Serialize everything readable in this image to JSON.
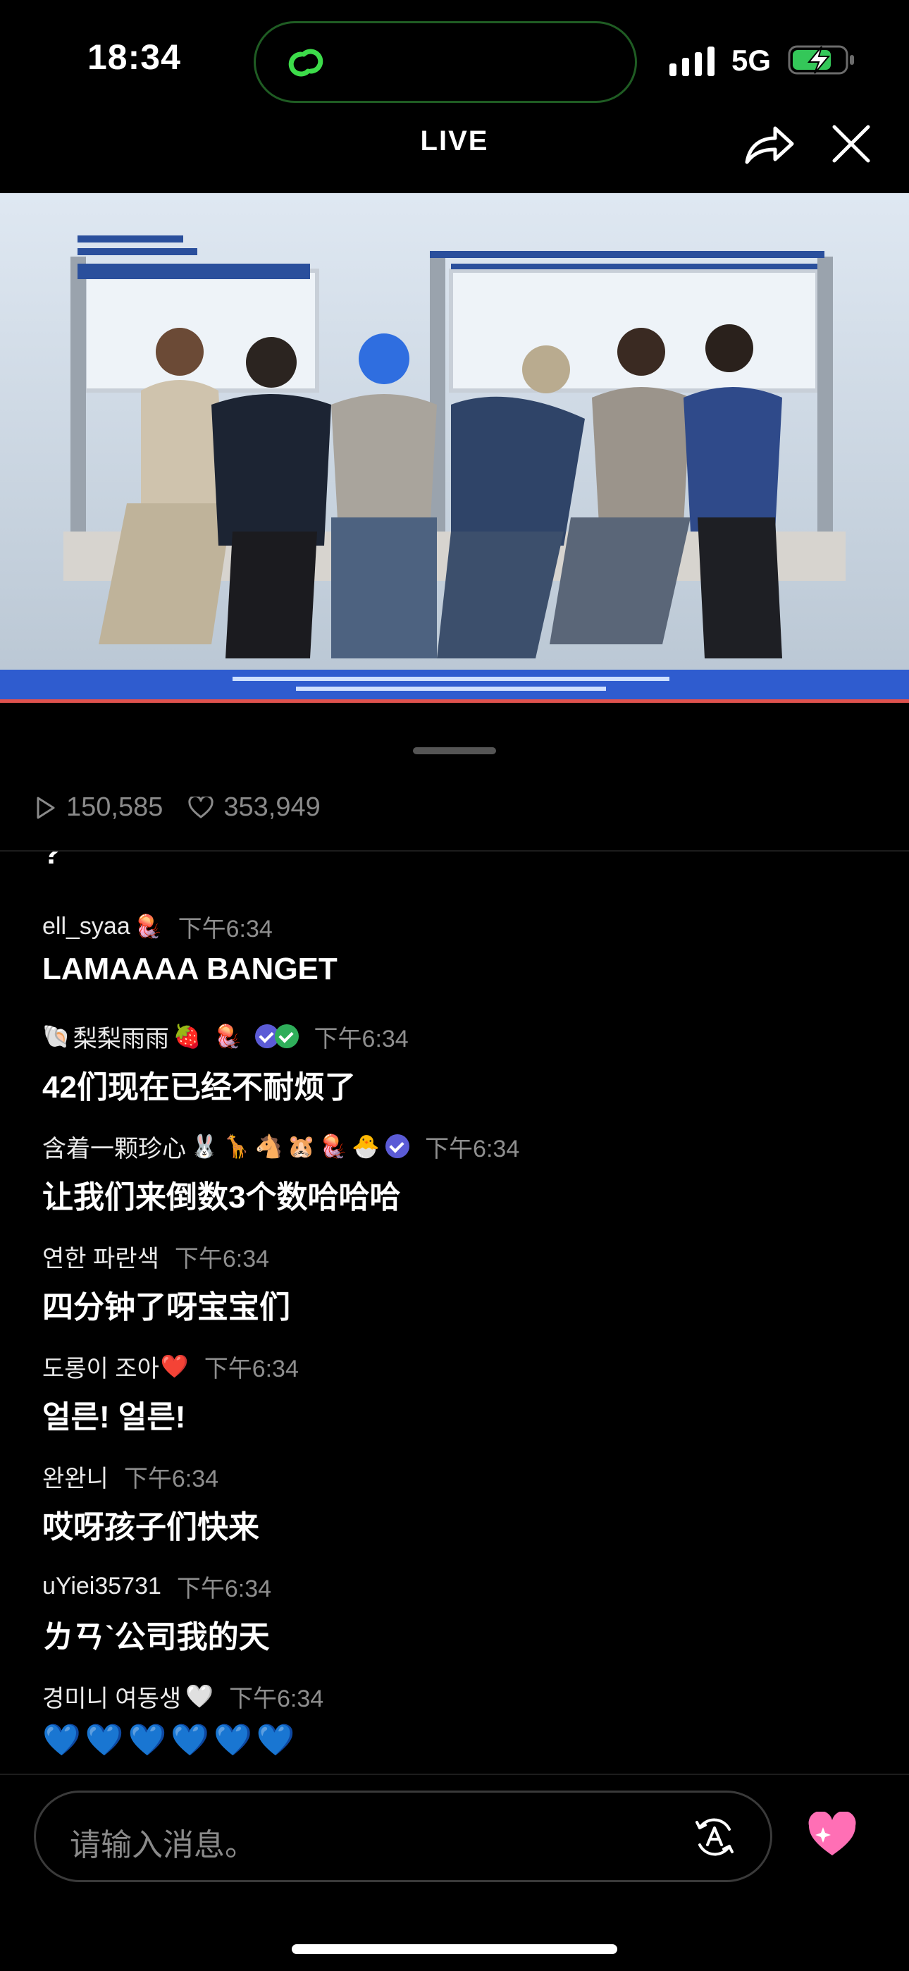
{
  "status_bar": {
    "time": "18:34",
    "network": "5G"
  },
  "header": {
    "title": "LIVE"
  },
  "stats": {
    "views": "150,585",
    "likes": "353,949"
  },
  "chat": {
    "partial_top": "?",
    "messages": [
      {
        "user": "ell_syaa",
        "time": "下午6:34",
        "text": "LAMAAAA BANGET",
        "badges": [
          "🪼"
        ]
      },
      {
        "user": "梨梨雨雨",
        "time": "下午6:34",
        "text": "42们现在已经不耐烦了",
        "prefix": "🐚",
        "badges": [
          "🍓",
          "🪼"
        ],
        "verified": 2
      },
      {
        "user": "含着一颗珍心",
        "time": "下午6:34",
        "text": "让我们来倒数3个数哈哈哈",
        "badges": [
          "🐰",
          "🦒",
          "🐴",
          "🐹",
          "🪼",
          "🐣"
        ],
        "verified": 1
      },
      {
        "user": "연한 파란색",
        "time": "下午6:34",
        "text": "四分钟了呀宝宝们"
      },
      {
        "user": "도롱이 조아",
        "time": "下午6:34",
        "text": "얼른! 얼른!",
        "badges": [
          "❤️"
        ]
      },
      {
        "user": "완완니",
        "time": "下午6:34",
        "text": "哎呀孩子们快来"
      },
      {
        "user": "uYiei35731",
        "time": "下午6:34",
        "text": "ㄌㄢˋ公司我的天"
      },
      {
        "user": "경미니 여동생",
        "time": "下午6:34",
        "text": "💙💙💙💙💙💙",
        "badges": [
          "🤍"
        ]
      }
    ]
  },
  "input": {
    "placeholder": "请输入消息。"
  },
  "colors": {
    "accent_heart": "#ff6fb5",
    "progress": "#e0524e",
    "verified_blue": "#5b5bd6",
    "verified_green": "#2fae5a"
  }
}
